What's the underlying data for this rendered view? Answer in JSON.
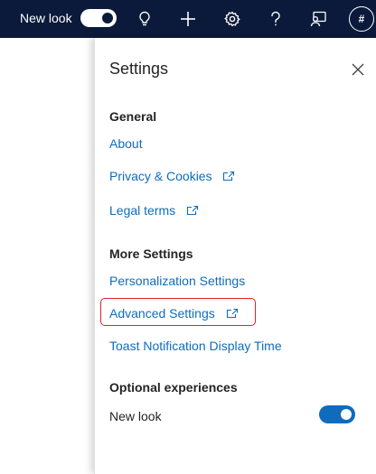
{
  "topbar": {
    "new_look_label": "New look",
    "new_look_toggle_on": true,
    "avatar_text": "#"
  },
  "settings": {
    "title": "Settings",
    "general": {
      "heading": "General",
      "about": "About",
      "privacy": "Privacy & Cookies",
      "legal": "Legal terms"
    },
    "more": {
      "heading": "More Settings",
      "personalization": "Personalization Settings",
      "advanced": "Advanced Settings",
      "toast": "Toast Notification Display Time"
    },
    "optional": {
      "heading": "Optional experiences",
      "new_look_label": "New look",
      "new_look_toggle_on": true
    }
  },
  "colors": {
    "topbar_bg": "#0b1a3a",
    "link": "#0f6cbd",
    "toggle_on": "#0f6cbd",
    "highlight_border": "#e0202a"
  },
  "icons": {
    "topbar": [
      "lightbulb-icon",
      "plus-icon",
      "gear-icon",
      "help-icon",
      "feedback-icon"
    ],
    "external_link": "external-link-icon",
    "close": "close-icon"
  }
}
